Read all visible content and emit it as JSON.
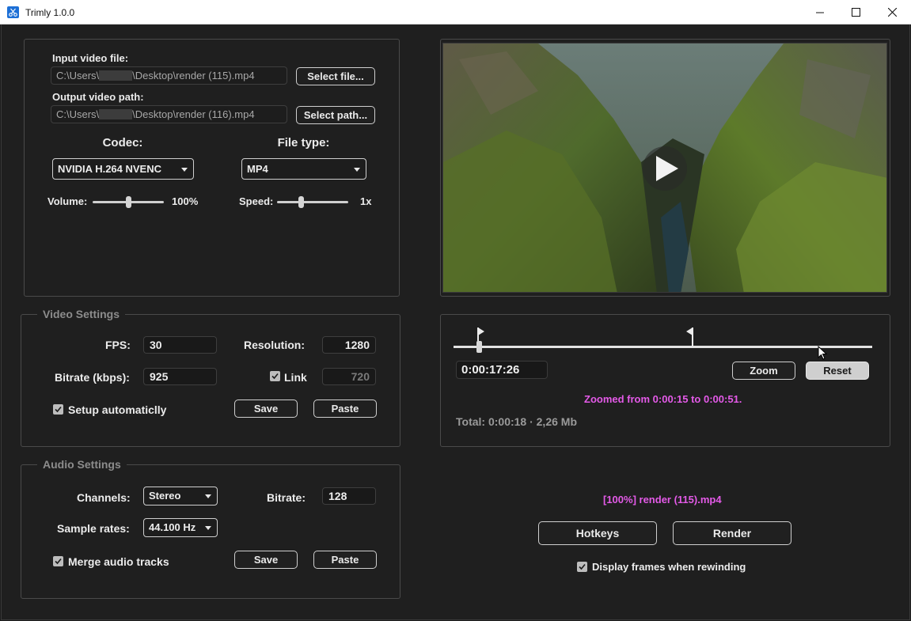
{
  "window": {
    "title": "Trimly 1.0.0"
  },
  "files": {
    "input_label": "Input video file:",
    "input_prefix": "C:\\Users\\",
    "input_suffix": "\\Desktop\\render (115).mp4",
    "select_file_label": "Select file...",
    "output_label": "Output video path:",
    "output_prefix": "C:\\Users\\",
    "output_suffix": "\\Desktop\\render (116).mp4",
    "select_path_label": "Select path..."
  },
  "encoding": {
    "codec_label": "Codec:",
    "codec_value": "NVIDIA H.264 NVENC",
    "filetype_label": "File type:",
    "filetype_value": "MP4",
    "volume_label": "Volume:",
    "volume_value": "100%",
    "volume_level": 0.5,
    "speed_label": "Speed:",
    "speed_value": "1x",
    "speed_level": 0.33
  },
  "video_settings": {
    "title": "Video Settings",
    "fps_label": "FPS:",
    "fps_value": "30",
    "resolution_label": "Resolution:",
    "resolution_width": "1280",
    "bitrate_label": "Bitrate (kbps):",
    "bitrate_value": "925",
    "link_label": "Link",
    "link_checked": true,
    "resolution_height": "720",
    "setup_auto_label": "Setup automaticlly",
    "setup_auto_checked": true,
    "save_label": "Save",
    "paste_label": "Paste"
  },
  "audio_settings": {
    "title": "Audio Settings",
    "channels_label": "Channels:",
    "channels_value": "Stereo",
    "bitrate_label": "Bitrate:",
    "bitrate_value": "128",
    "sample_rates_label": "Sample rates:",
    "sample_rates_value": "44.100 Hz",
    "merge_label": "Merge audio tracks",
    "merge_checked": true,
    "save_label": "Save",
    "paste_label": "Paste"
  },
  "timeline": {
    "timecode": "0:00:17:26",
    "zoom_label": "Zoom",
    "reset_label": "Reset",
    "zoom_info": "Zoomed from 0:00:15 to 0:00:51.",
    "total_info": "Total: 0:00:18 · 2,26 Mb",
    "playhead_position": 0.054,
    "start_marker_position": 0.058,
    "end_marker_position": 0.571
  },
  "render": {
    "progress_text": "[100%] render (115).mp4",
    "hotkeys_label": "Hotkeys",
    "render_label": "Render",
    "display_frames_label": "Display frames when rewinding",
    "display_frames_checked": true
  },
  "colors": {
    "accent": "#e45ae8",
    "background": "#1f1f1f",
    "panel_border": "#4a4a4a"
  },
  "icons": {
    "app": "scissors-icon",
    "minimize": "minimize-icon",
    "maximize": "maximize-icon",
    "close": "close-icon",
    "play": "play-icon",
    "check": "checkmark-icon"
  }
}
